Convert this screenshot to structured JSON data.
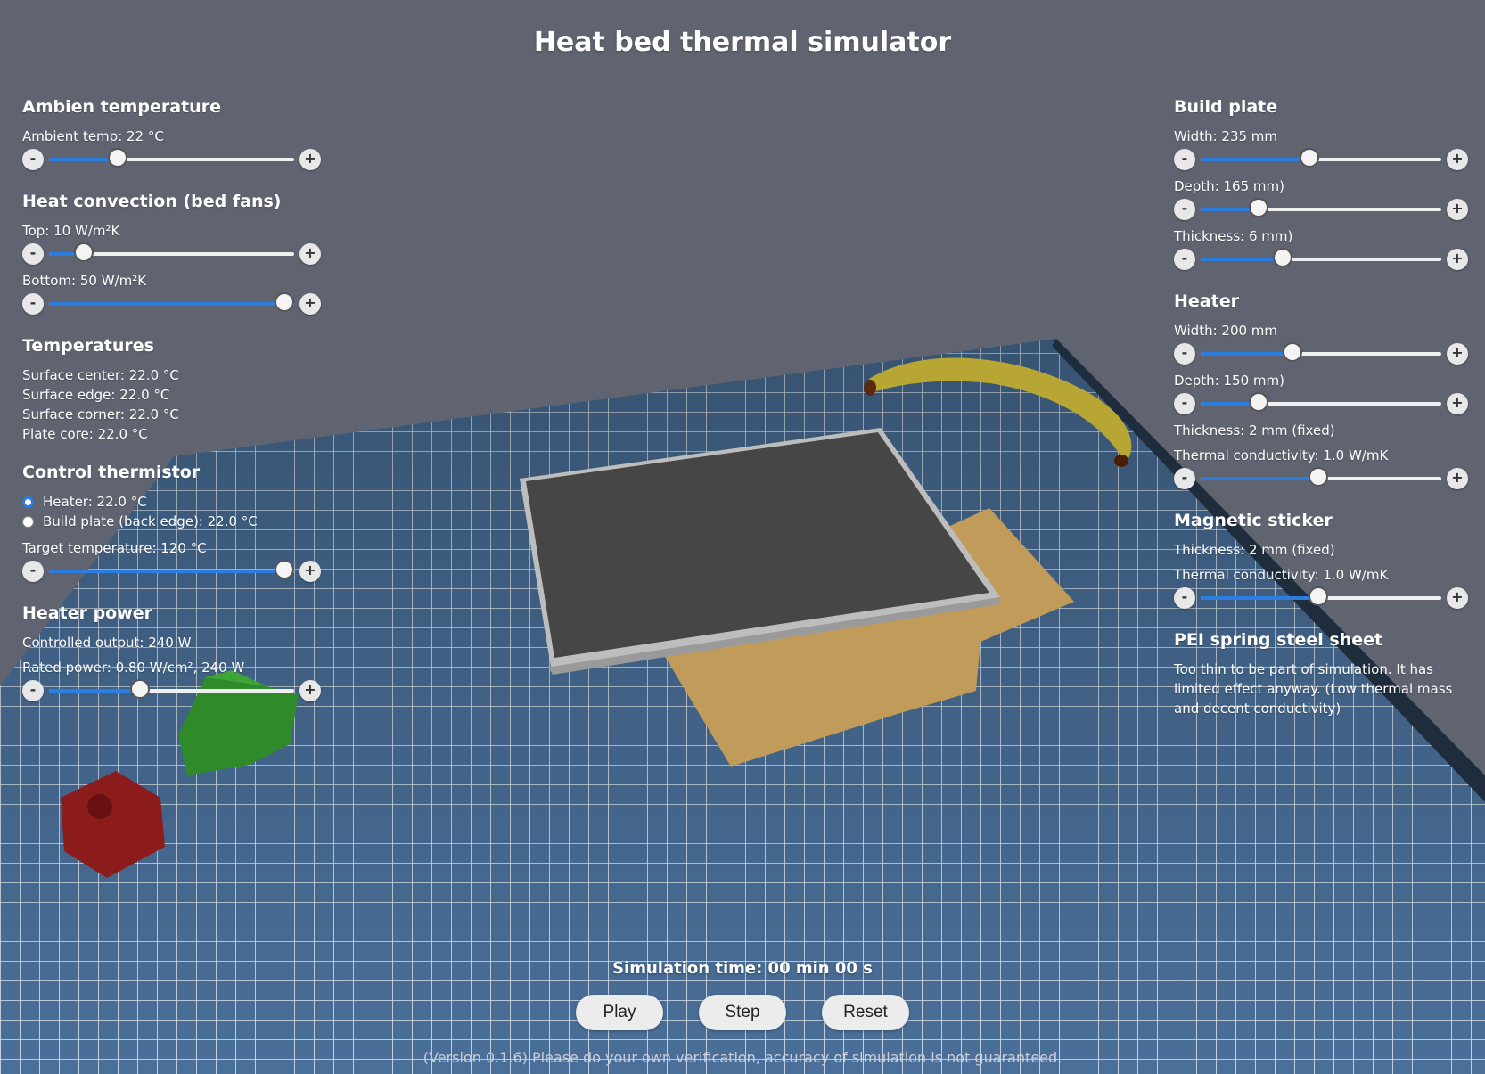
{
  "title": "Heat bed thermal simulator",
  "left": {
    "ambient": {
      "heading": "Ambien temperature",
      "slider": {
        "label": "Ambient temp: 22 °C",
        "fraction": 0.28
      }
    },
    "convection": {
      "heading": "Heat convection (bed fans)",
      "top": {
        "label": "Top: 10 W/m²K",
        "fraction": 0.14
      },
      "bottom": {
        "label": "Bottom: 50 W/m²K",
        "fraction": 0.96
      }
    },
    "temperatures": {
      "heading": "Temperatures",
      "rows": [
        "Surface center: 22.0 °C",
        "Surface edge: 22.0 °C",
        "Surface corner: 22.0 °C",
        "Plate core: 22.0 °C"
      ]
    },
    "thermistor": {
      "heading": "Control thermistor",
      "options": [
        {
          "label": "Heater: 22.0 °C",
          "selected": true
        },
        {
          "label": "Build plate (back edge): 22.0 °C",
          "selected": false
        }
      ],
      "target": {
        "label": "Target temperature: 120 °C",
        "fraction": 0.96
      }
    },
    "power": {
      "heading": "Heater power",
      "output": "Controlled output: 240 W",
      "rated": {
        "label": "Rated power: 0.80 W/cm², 240 W",
        "fraction": 0.37
      }
    }
  },
  "right": {
    "plate": {
      "heading": "Build plate",
      "width": {
        "label": "Width: 235 mm",
        "fraction": 0.45
      },
      "depth": {
        "label": "Depth: 165 mm)",
        "fraction": 0.24
      },
      "thickness": {
        "label": "Thickness: 6 mm)",
        "fraction": 0.34
      }
    },
    "heater": {
      "heading": "Heater",
      "width": {
        "label": "Width: 200 mm",
        "fraction": 0.38
      },
      "depth": {
        "label": "Depth: 150 mm)",
        "fraction": 0.24
      },
      "thickness": "Thickness: 2 mm (fixed)",
      "conductivity": {
        "label": "Thermal conductivity: 1.0 W/mK",
        "fraction": 0.49
      }
    },
    "sticker": {
      "heading": "Magnetic sticker",
      "thickness": "Thickness: 2 mm (fixed)",
      "conductivity": {
        "label": "Thermal conductivity: 1.0 W/mK",
        "fraction": 0.49
      }
    },
    "pei": {
      "heading": "PEI spring steel sheet",
      "text": "Too thin to be part of simulation. It has limited effect anyway. (Low thermal mass and decent conductivity)"
    }
  },
  "minus": "-",
  "plus": "+",
  "sim_time": "Simulation time: 00 min 00 s",
  "buttons": {
    "play": "Play",
    "step": "Step",
    "reset": "Reset"
  },
  "version": "(Version 0.1.6) Please do your own verification, accuracy of simulation is not guaranteed.",
  "colors": {
    "accent": "#2b7de0",
    "background": "#5f6470",
    "mat": "#4a6f98"
  },
  "scene_objects": [
    "cutting-mat",
    "heat-bed-plate",
    "magnetic-sticker",
    "banana",
    "benchy-boat",
    "calibration-cube"
  ]
}
